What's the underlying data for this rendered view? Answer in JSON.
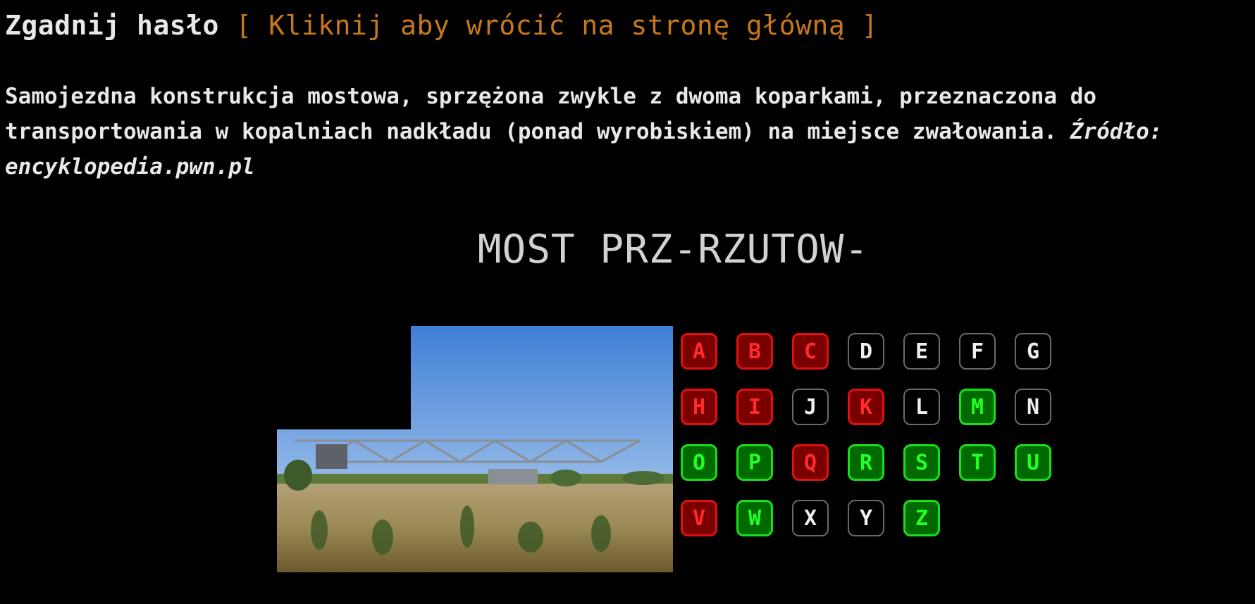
{
  "header": {
    "title": "Zgadnij hasło",
    "home_link": "[ Kliknij aby wrócić na stronę główną ]"
  },
  "clue": {
    "text": "Samojezdna konstrukcja mostowa, sprzężona zwykle z dwoma koparkami, przeznaczona do transportowania w kopalniach nadkładu (ponad wyrobiskiem) na miejsce zwałowania. ",
    "source": "Źródło: encyklopedia.pwn.pl"
  },
  "puzzle": {
    "word_display": "MOST PRZ-RZUTOW-"
  },
  "colors": {
    "wrong_fill": "#7a0000",
    "wrong_border": "#e01010",
    "right_fill": "#006a00",
    "right_border": "#18e018",
    "unused_border": "#6a6a6a",
    "link": "#c8781a"
  },
  "letters": [
    {
      "label": "A",
      "state": "wrong"
    },
    {
      "label": "B",
      "state": "wrong"
    },
    {
      "label": "C",
      "state": "wrong"
    },
    {
      "label": "D",
      "state": "unused"
    },
    {
      "label": "E",
      "state": "unused"
    },
    {
      "label": "F",
      "state": "unused"
    },
    {
      "label": "G",
      "state": "unused"
    },
    {
      "label": "H",
      "state": "wrong"
    },
    {
      "label": "I",
      "state": "wrong"
    },
    {
      "label": "J",
      "state": "unused"
    },
    {
      "label": "K",
      "state": "wrong"
    },
    {
      "label": "L",
      "state": "unused"
    },
    {
      "label": "M",
      "state": "right"
    },
    {
      "label": "N",
      "state": "unused"
    },
    {
      "label": "O",
      "state": "right"
    },
    {
      "label": "P",
      "state": "right"
    },
    {
      "label": "Q",
      "state": "wrong"
    },
    {
      "label": "R",
      "state": "right"
    },
    {
      "label": "S",
      "state": "right"
    },
    {
      "label": "T",
      "state": "right"
    },
    {
      "label": "U",
      "state": "right"
    },
    {
      "label": "V",
      "state": "wrong"
    },
    {
      "label": "W",
      "state": "right"
    },
    {
      "label": "X",
      "state": "unused"
    },
    {
      "label": "Y",
      "state": "unused"
    },
    {
      "label": "Z",
      "state": "right"
    }
  ]
}
